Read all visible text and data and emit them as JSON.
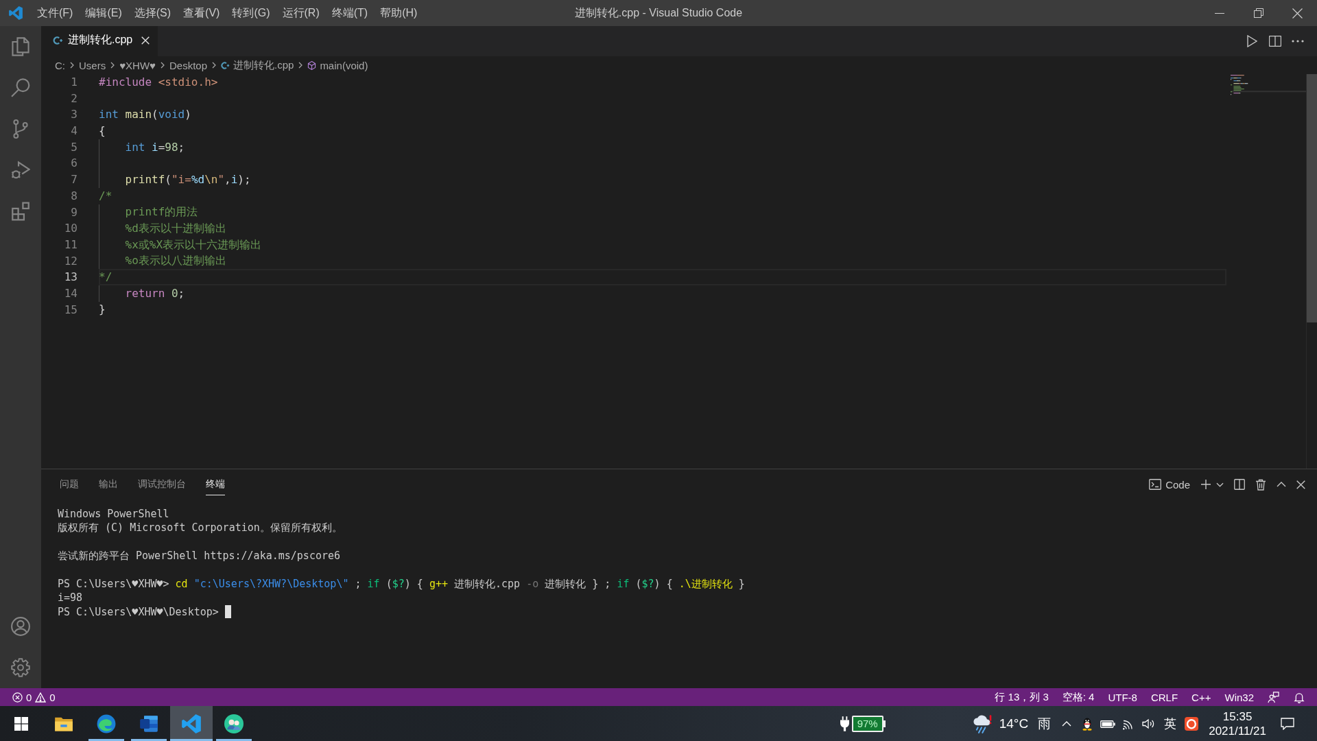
{
  "title_bar": {
    "menus": [
      "文件(F)",
      "编辑(E)",
      "选择(S)",
      "查看(V)",
      "转到(G)",
      "运行(R)",
      "终端(T)",
      "帮助(H)"
    ],
    "title": "进制转化.cpp - Visual Studio Code"
  },
  "tabs": [
    {
      "label": "进制转化.cpp",
      "selected": true
    }
  ],
  "breadcrumb": [
    {
      "kind": "path",
      "text": "C:"
    },
    {
      "kind": "path",
      "text": "Users"
    },
    {
      "kind": "path",
      "text": "♥XHW♥"
    },
    {
      "kind": "path",
      "text": "Desktop"
    },
    {
      "kind": "file",
      "text": "进制转化.cpp"
    },
    {
      "kind": "symbol",
      "text": "main(void)"
    }
  ],
  "editor": {
    "lines": [
      {
        "number": "1",
        "current": false,
        "indented": false,
        "tokens": [
          {
            "kind": "preprocessor",
            "text": "#include "
          },
          {
            "kind": "string",
            "text": "<stdio.h>"
          }
        ]
      },
      {
        "number": "2",
        "current": false,
        "indented": false
      },
      {
        "number": "3",
        "current": false,
        "indented": false,
        "tokens": [
          {
            "kind": "keyword",
            "text": "int "
          },
          {
            "kind": "function",
            "text": "main"
          },
          {
            "kind": "punctuation",
            "text": "("
          },
          {
            "kind": "keyword",
            "text": "void"
          },
          {
            "kind": "punctuation",
            "text": ")"
          }
        ]
      },
      {
        "number": "4",
        "current": false,
        "indented": false,
        "tokens": [
          {
            "kind": "punctuation",
            "text": "{"
          }
        ]
      },
      {
        "number": "5",
        "current": false,
        "indented": true,
        "tokens": [
          {
            "kind": "keyword",
            "text": "int "
          },
          {
            "kind": "variable",
            "text": "i"
          },
          {
            "kind": "punctuation",
            "text": "="
          },
          {
            "kind": "number",
            "text": "98"
          },
          {
            "kind": "punctuation",
            "text": ";"
          }
        ]
      },
      {
        "number": "6",
        "current": false,
        "indented": true
      },
      {
        "number": "7",
        "current": false,
        "indented": true,
        "tokens": [
          {
            "kind": "function",
            "text": "printf"
          },
          {
            "kind": "punctuation",
            "text": "("
          },
          {
            "kind": "string",
            "text": "\"i="
          },
          {
            "kind": "format",
            "text": "%d"
          },
          {
            "kind": "escape",
            "text": "\\n"
          },
          {
            "kind": "string",
            "text": "\""
          },
          {
            "kind": "punctuation",
            "text": ","
          },
          {
            "kind": "variable",
            "text": "i"
          },
          {
            "kind": "punctuation",
            "text": ");"
          }
        ]
      },
      {
        "number": "8",
        "current": false,
        "indented": false,
        "tokens": [
          {
            "kind": "comment",
            "text": "/*"
          }
        ]
      },
      {
        "number": "9",
        "current": false,
        "indented": true,
        "tokens": [
          {
            "kind": "comment",
            "text": "printf的用法"
          }
        ]
      },
      {
        "number": "10",
        "current": false,
        "indented": true,
        "tokens": [
          {
            "kind": "comment",
            "text": "%d表示以十进制输出"
          }
        ]
      },
      {
        "number": "11",
        "current": false,
        "indented": true,
        "tokens": [
          {
            "kind": "comment",
            "text": "%x或%X表示以十六进制输出"
          }
        ]
      },
      {
        "number": "12",
        "current": false,
        "indented": true,
        "tokens": [
          {
            "kind": "comment",
            "text": "%o表示以八进制输出"
          }
        ]
      },
      {
        "number": "13",
        "current": true,
        "indented": false,
        "tokens": [
          {
            "kind": "comment",
            "text": "*/"
          }
        ]
      },
      {
        "number": "14",
        "current": false,
        "indented": true,
        "tokens": [
          {
            "kind": "control",
            "text": "return "
          },
          {
            "kind": "number",
            "text": "0"
          },
          {
            "kind": "punctuation",
            "text": ";"
          }
        ]
      },
      {
        "number": "15",
        "current": false,
        "indented": false,
        "tokens": [
          {
            "kind": "punctuation",
            "text": "}"
          }
        ]
      }
    ]
  },
  "panel": {
    "tabs": [
      {
        "label": "问题",
        "selected": false
      },
      {
        "label": "输出",
        "selected": false
      },
      {
        "label": "调试控制台",
        "selected": false
      },
      {
        "label": "终端",
        "selected": true
      }
    ],
    "terminal_name": "Code",
    "terminal": {
      "lines": [
        {
          "blank_before": false,
          "cursor": false,
          "tokens": [
            {
              "kind": "plain",
              "text": "Windows PowerShell"
            }
          ]
        },
        {
          "blank_before": false,
          "cursor": false,
          "tokens": [
            {
              "kind": "plain",
              "text": "版权所有 (C) Microsoft Corporation。保留所有权利。"
            }
          ]
        },
        {
          "blank_before": true,
          "cursor": false,
          "tokens": [
            {
              "kind": "plain",
              "text": "尝试新的跨平台 PowerShell https://aka.ms/pscore6"
            }
          ]
        },
        {
          "blank_before": true,
          "cursor": false,
          "tokens": [
            {
              "kind": "plain",
              "text": "PS C:\\Users\\♥XHW♥> "
            },
            {
              "kind": "command",
              "text": "cd "
            },
            {
              "kind": "string",
              "text": "\"c:\\Users\\?XHW?\\Desktop\\\""
            },
            {
              "kind": "plain",
              "text": " ; "
            },
            {
              "kind": "keyword",
              "text": "if"
            },
            {
              "kind": "plain",
              "text": " ("
            },
            {
              "kind": "variable",
              "text": "$?"
            },
            {
              "kind": "plain",
              "text": ") { "
            },
            {
              "kind": "command",
              "text": "g++"
            },
            {
              "kind": "plain",
              "text": " 进制转化.cpp "
            },
            {
              "kind": "parameter",
              "text": "-o"
            },
            {
              "kind": "plain",
              "text": " 进制转化 } ; "
            },
            {
              "kind": "keyword",
              "text": "if"
            },
            {
              "kind": "plain",
              "text": " ("
            },
            {
              "kind": "variable",
              "text": "$?"
            },
            {
              "kind": "plain",
              "text": ") { "
            },
            {
              "kind": "command",
              "text": ".\\进制转化"
            },
            {
              "kind": "plain",
              "text": " }"
            }
          ]
        },
        {
          "blank_before": false,
          "cursor": false,
          "tokens": [
            {
              "kind": "plain",
              "text": "i=98"
            }
          ]
        },
        {
          "blank_before": false,
          "cursor": true,
          "tokens": [
            {
              "kind": "plain",
              "text": "PS C:\\Users\\♥XHW♥\\Desktop> "
            }
          ]
        }
      ]
    }
  },
  "status_bar": {
    "errors": "0",
    "warnings": "0",
    "items": [
      "行 13，列 3",
      "空格: 4",
      "UTF-8",
      "CRLF",
      "C++",
      "Win32"
    ]
  },
  "taskbar": {
    "apps": [
      {
        "running": false,
        "selected": false
      },
      {
        "running": true,
        "selected": false
      },
      {
        "running": true,
        "selected": false
      },
      {
        "running": true,
        "selected": true
      },
      {
        "running": true,
        "selected": false
      }
    ],
    "battery": "97%",
    "weather": {
      "temperature": "14°C",
      "condition": "雨"
    },
    "input_method": "英",
    "time": "15:35",
    "date": "2021/11/21"
  }
}
